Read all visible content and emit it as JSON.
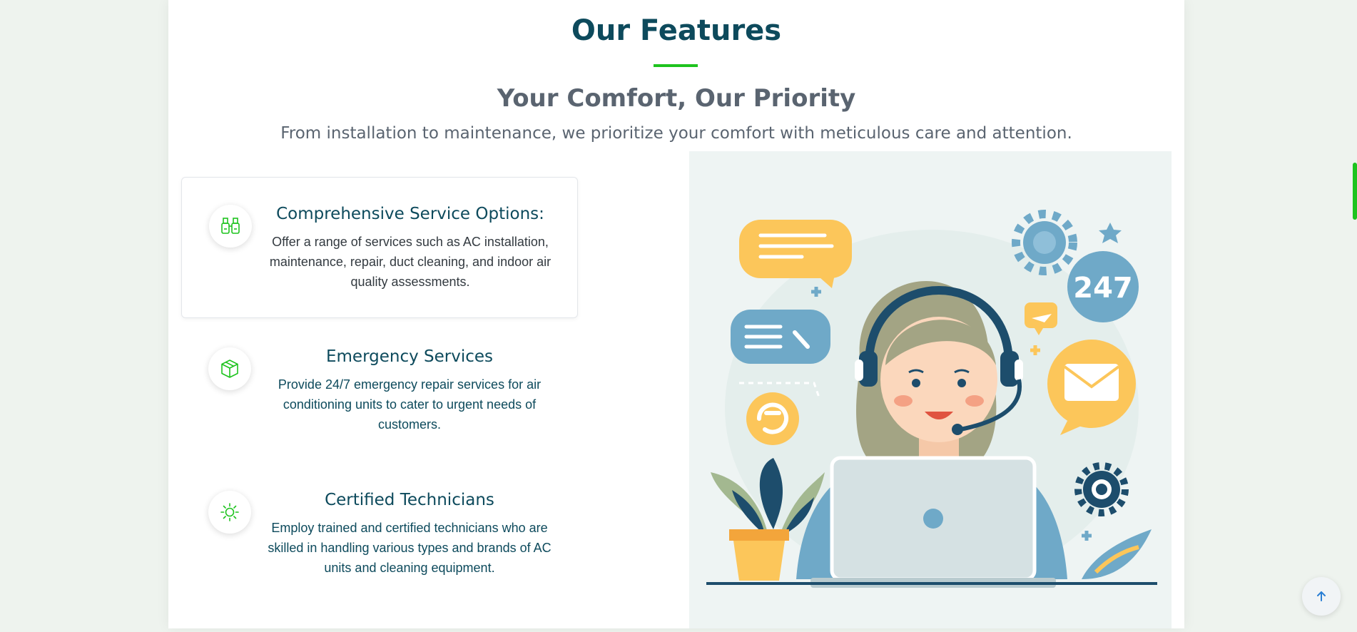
{
  "section": {
    "title": "Our Features",
    "subtitle": "Your Comfort, Our Priority",
    "description": "From installation to maintenance, we prioritize your comfort with meticulous care and attention."
  },
  "features": [
    {
      "icon": "binoculars-icon",
      "title": "Comprehensive Service Options:",
      "description": "Offer a range of services such as AC installation, maintenance, repair, duct cleaning, and indoor air quality assessments."
    },
    {
      "icon": "box-icon",
      "title": "Emergency Services",
      "description": "Provide 24/7 emergency repair services for air conditioning units to cater to urgent needs of customers."
    },
    {
      "icon": "sun-icon",
      "title": "Certified Technicians",
      "description": "Employ trained and certified technicians who are skilled in handling various types and brands of AC units and cleaning equipment."
    }
  ],
  "illustration": {
    "badge_text": "247"
  },
  "colors": {
    "accent": "#1ec31e",
    "heading": "#0d4a5c",
    "muted": "#5a6470",
    "panel_bg": "#ffffff",
    "page_bg": "#eef3ee"
  },
  "controls": {
    "back_to_top_icon": "arrow-up-icon"
  }
}
